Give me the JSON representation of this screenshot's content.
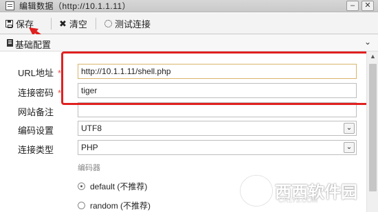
{
  "window": {
    "title": "编辑数据（http://10.1.1.11）",
    "minimize_label": "–",
    "close_label": "✕"
  },
  "toolbar": {
    "save_label": "保存",
    "clear_label": "清空",
    "test_label": "测试连接",
    "clear_icon": "✖"
  },
  "section": {
    "title": "基础配置",
    "chevron": "⌄"
  },
  "form": {
    "url": {
      "label": "URL地址",
      "required_mark": "*",
      "value": "http://10.1.1.11/shell.php"
    },
    "password": {
      "label": "连接密码",
      "required_mark": "*",
      "value": "tiger"
    },
    "note": {
      "label": "网站备注",
      "value": ""
    },
    "encoding": {
      "label": "编码设置",
      "value": "UTF8"
    },
    "type": {
      "label": "连接类型",
      "value": "PHP"
    },
    "encoder_heading": "编码器",
    "encoders": [
      {
        "label": "default (不推荐)",
        "selected": true
      },
      {
        "label": "random (不推荐)",
        "selected": false
      }
    ]
  },
  "watermark": {
    "logo_letter": "C",
    "text": "西西软件园",
    "url": "CR173.COM"
  },
  "colors": {
    "highlight": "#e02020",
    "focus_border": "#d8b46a"
  }
}
